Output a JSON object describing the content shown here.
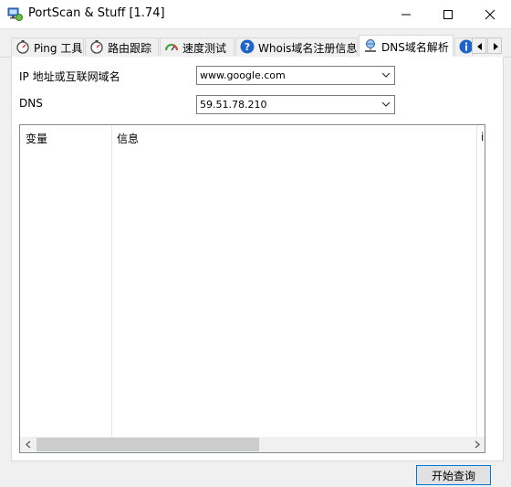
{
  "window": {
    "title": "PortScan & Stuff [1.74]"
  },
  "tabs": [
    {
      "label": "Ping 工具",
      "icon": "stopwatch-icon"
    },
    {
      "label": "路由跟踪",
      "icon": "stopwatch-icon"
    },
    {
      "label": "速度测试",
      "icon": "speedometer-icon"
    },
    {
      "label": "Whois域名注册信息",
      "icon": "question-icon"
    },
    {
      "label": "DNS域名解析",
      "icon": "network-globe-icon",
      "active": true
    }
  ],
  "form": {
    "host_label": "IP 地址或互联网域名",
    "host_value": "www.google.com",
    "dns_label": "DNS",
    "dns_value": "59.51.78.210"
  },
  "results": {
    "columns": [
      "变量",
      "信息",
      "i"
    ]
  },
  "actions": {
    "start_label": "开始查询"
  },
  "colors": {
    "accent": "#0078d7",
    "help_icon": "#1e64c8"
  }
}
